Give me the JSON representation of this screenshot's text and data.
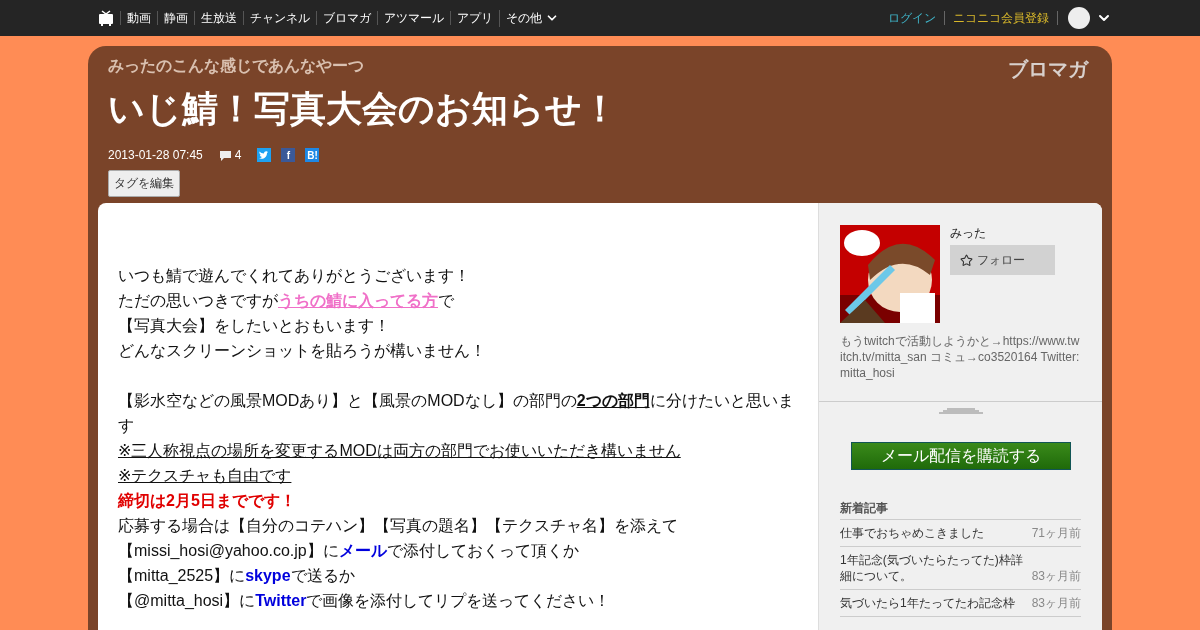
{
  "nav": {
    "items": [
      "動画",
      "静画",
      "生放送",
      "チャンネル",
      "ブロマガ",
      "アツマール",
      "アプリ"
    ],
    "more": "その他",
    "login": "ログイン",
    "register": "ニコニコ会員登録"
  },
  "header": {
    "blog_name": "みったのこんな感じであんなやーつ",
    "logo": "ブロマガ",
    "title": "いじ鯖！写真大会のお知らせ！",
    "date": "2013-01-28 07:45",
    "comments": "4",
    "share_icons": [
      {
        "kind": "twitter"
      },
      {
        "kind": "facebook",
        "text": "f"
      },
      {
        "kind": "hatena",
        "text": "B!"
      }
    ],
    "tag_button": "タグを編集"
  },
  "article": {
    "lines": [
      [
        {
          "kind": "plain",
          "text": "いつも鯖で遊んでくれてありがとうございます！"
        }
      ],
      [
        {
          "kind": "plain",
          "text": "ただの思いつきですが"
        },
        {
          "kind": "link",
          "text": "うちの鯖に入ってる方"
        },
        {
          "kind": "plain",
          "text": "で"
        }
      ],
      [
        {
          "kind": "plain",
          "text": "【写真大会】をしたいとおもいます！"
        }
      ],
      [
        {
          "kind": "plain",
          "text": "どんなスクリーンショットを貼ろうが構いません！"
        }
      ],
      [
        {
          "kind": "gap"
        },
        {
          "kind": "plain",
          "text": "【影水空などの風景MODあり】と【風景のMODなし】の部門の"
        },
        {
          "kind": "bold_underline",
          "text": "2つの部門"
        },
        {
          "kind": "plain",
          "text": "に分けたいと思います"
        }
      ],
      [
        {
          "kind": "underline",
          "text": "※三人称視点の場所を変更するMODは両方の部門でお使いいただき構いません"
        }
      ],
      [
        {
          "kind": "underline",
          "text": "※テクスチャも自由です"
        }
      ],
      [
        {
          "kind": "red_bold",
          "text": "締切は2月5日までです！"
        }
      ],
      [
        {
          "kind": "plain",
          "text": "応募する場合は【自分のコテハン】【写真の題名】【テクスチャ名】を添えて"
        }
      ],
      [
        {
          "kind": "plain",
          "text": "【missi_hosi@yahoo.co.jp】に"
        },
        {
          "kind": "blue_bold",
          "text": "メール"
        },
        {
          "kind": "plain",
          "text": "で添付しておくって頂くか"
        }
      ],
      [
        {
          "kind": "plain",
          "text": "【mitta_2525】に"
        },
        {
          "kind": "blue_bold",
          "text": "skype"
        },
        {
          "kind": "plain",
          "text": "で送るか"
        }
      ],
      [
        {
          "kind": "plain",
          "text": "【@mitta_hosi】に"
        },
        {
          "kind": "blue_bold",
          "text": "Twitter"
        },
        {
          "kind": "plain",
          "text": "で画像を添付してリプを送ってください！"
        }
      ]
    ]
  },
  "sidebar": {
    "author": "みった",
    "follow": "フォロー",
    "bio": "もうtwitchで活動しようかと→https://www.twitch.tv/mitta_san コミュ→co3520164 Twitter:mitta_hosi",
    "subscribe": "メール配信を購読する",
    "recent_heading": "新着記事",
    "recent": [
      {
        "title": "仕事でおちゃめこきました",
        "time": "71ヶ月前"
      },
      {
        "title": "1年記念(気づいたらたってた)枠詳細について。",
        "time": "83ヶ月前"
      },
      {
        "title": "気づいたら1年たってたわ記念枠",
        "time": "83ヶ月前"
      }
    ]
  }
}
